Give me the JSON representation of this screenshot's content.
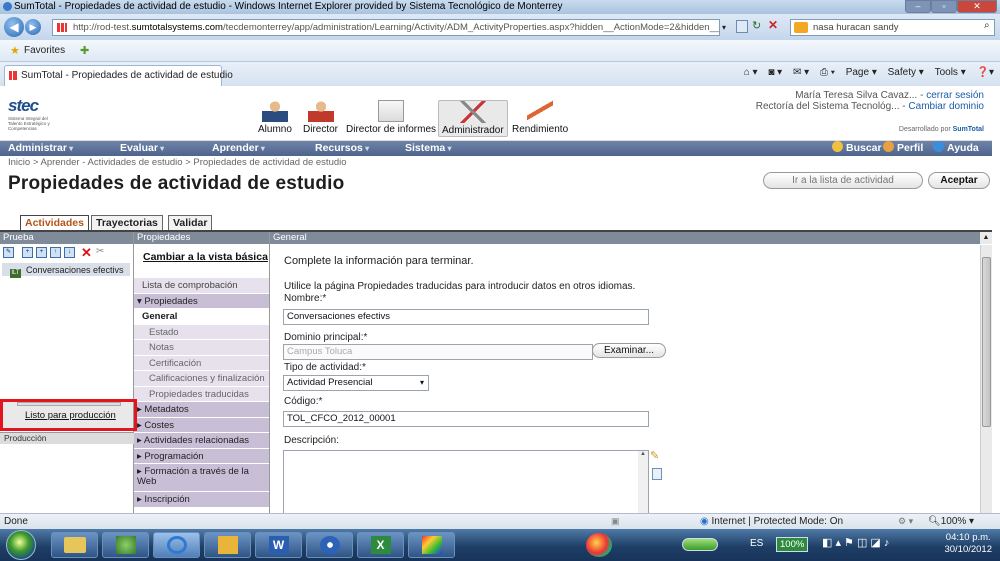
{
  "window": {
    "title": "SumTotal - Propiedades de actividad de estudio - Windows Internet Explorer provided by Sistema Tecnológico de Monterrey",
    "url_prefix": "http://rod-test.",
    "url_domain": "sumtotalsystems.com",
    "url_rest": "/tecdemonterrey/app/administration/Learning/Activity/ADM_ActivityProperties.aspx?hidden__ActionMode=2&hidden__Activ",
    "search_text": "nasa huracan sandy",
    "favorites_label": "Favorites",
    "tab_title": "SumTotal - Propiedades de actividad de estudio",
    "cmd_page": "Page ▾",
    "cmd_safety": "Safety ▾",
    "cmd_tools": "Tools ▾"
  },
  "header": {
    "logo_text": "stec",
    "logo_sub": "Sistema Integral del Talento Estratégico y Competencias",
    "roles": [
      "Alumno",
      "Director",
      "Director de informes",
      "Administrador",
      "Rendimiento"
    ],
    "user_line1": "María Teresa Silva Cavaz...",
    "logout": "cerrar sesión",
    "user_line2": "Rectoría del Sistema Tecnológ...",
    "change_domain": "Cambiar dominio",
    "powered_prefix": "Desarrollado por",
    "powered_brand": "SumTotal"
  },
  "menu": {
    "items": [
      "Administrar",
      "Evaluar",
      "Aprender",
      "Recursos",
      "Sistema"
    ],
    "search": "Buscar",
    "profile": "Perfil",
    "help": "Ayuda"
  },
  "page": {
    "breadcrumb": "Inicio > Aprender - Actividades de estudio > Propiedades de actividad de estudio",
    "title": "Propiedades de actividad de estudio",
    "go_to_list": "Ir a la lista de actividad",
    "accept": "Aceptar",
    "tabs": [
      "Actividades",
      "Trayectorias",
      "Validar"
    ]
  },
  "left_panel": {
    "header": "Prueba",
    "tree_item": "Conversaciones efectivs",
    "ready_link": "Listo para producción",
    "prod_label": "Producción"
  },
  "mid_panel": {
    "header": "Propiedades",
    "switch_view": "Cambiar a la vista básica",
    "items": [
      {
        "label": "Lista de comprobación",
        "kind": "item"
      },
      {
        "label": "▾ Propiedades",
        "kind": "sec"
      },
      {
        "label": "General",
        "kind": "act"
      },
      {
        "label": "Estado",
        "kind": "sub"
      },
      {
        "label": "Notas",
        "kind": "sub"
      },
      {
        "label": "Certificación",
        "kind": "sub"
      },
      {
        "label": "Calificaciones y finalización",
        "kind": "sub"
      },
      {
        "label": "Propiedades traducidas",
        "kind": "sub"
      },
      {
        "label": "▸ Metadatos",
        "kind": "sec"
      },
      {
        "label": "▸ Costes",
        "kind": "sec"
      },
      {
        "label": "▸ Actividades relacionadas",
        "kind": "sec"
      },
      {
        "label": "▸ Programación",
        "kind": "sec"
      },
      {
        "label": "▸ Formación a través de la Web",
        "kind": "sec tall"
      },
      {
        "label": "▸ Inscripción",
        "kind": "sec"
      }
    ]
  },
  "form": {
    "header": "General",
    "intro": "Complete la información para terminar.",
    "translated_note": "Utilice la página Propiedades traducidas para introducir datos en otros idiomas.",
    "name_label": "Nombre:*",
    "name_value": "Conversaciones efectivs",
    "domain_label": "Dominio principal:*",
    "domain_value": "Campus Toluca",
    "browse": "Examinar...",
    "type_label": "Tipo de actividad:*",
    "type_value": "Actividad Presencial",
    "code_label": "Código:*",
    "code_value": "TOL_CFCO_2012_00001",
    "desc_label": "Descripción:"
  },
  "status": {
    "left": "Done",
    "zone": "Internet | Protected Mode: On",
    "zoom": "100%"
  },
  "taskbar": {
    "lang": "ES",
    "zoom": "100%",
    "time": "04:10 p.m.",
    "date": "30/10/2012"
  }
}
